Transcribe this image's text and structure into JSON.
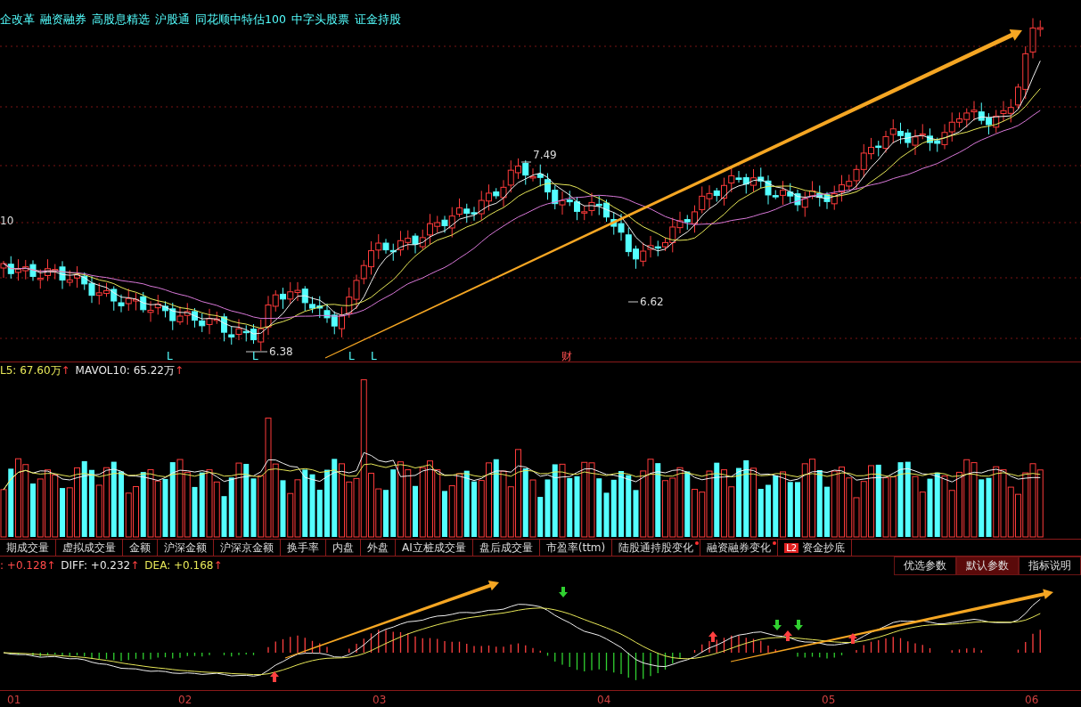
{
  "concept_tags": [
    "企改革",
    "融资融券",
    "高股息精选",
    "沪股通",
    "同花顺中特估100",
    "中字头股票",
    "证金持股"
  ],
  "price_panel": {
    "axis_label": "10",
    "annotations": [
      {
        "text": "7.49"
      },
      {
        "text": "6.38"
      },
      {
        "text": "6.62"
      }
    ],
    "markers": [
      {
        "text": "L",
        "kind": "signal"
      },
      {
        "text": "L",
        "kind": "signal"
      },
      {
        "text": "L",
        "kind": "signal"
      },
      {
        "text": "L",
        "kind": "signal"
      },
      {
        "text": "财",
        "kind": "report"
      }
    ]
  },
  "volume_panel": {
    "indicators": [
      {
        "text": "L5: 67.60万",
        "arrow": "↑",
        "color": "#e8e858"
      },
      {
        "text": "MAVOL10: 65.22万",
        "arrow": "↑",
        "color": "#e8e8e8"
      }
    ]
  },
  "indicator_tabs": [
    {
      "label": "期成交量",
      "dot": false
    },
    {
      "label": "虚拟成交量",
      "dot": false
    },
    {
      "label": "金额",
      "dot": false
    },
    {
      "label": "沪深金额",
      "dot": false
    },
    {
      "label": "沪深京金额",
      "dot": false
    },
    {
      "label": "换手率",
      "dot": false
    },
    {
      "label": "内盘",
      "dot": false
    },
    {
      "label": "外盘",
      "dot": false
    },
    {
      "label": "AI立桩成交量",
      "dot": false
    },
    {
      "label": "盘后成交量",
      "dot": false
    },
    {
      "label": "市盈率(ttm)",
      "dot": false
    },
    {
      "label": "陆股通持股变化",
      "dot": true
    },
    {
      "label": "融资融券变化",
      "dot": true
    },
    {
      "label": "资金抄底",
      "dot": false,
      "badge": "L2"
    }
  ],
  "macd_panel": {
    "indicators": [
      {
        "text": ": +0.128",
        "arrow": "↑",
        "color": "#ff4a4a"
      },
      {
        "text": "DIFF: +0.232",
        "arrow": "↑",
        "color": "#e8e8e8"
      },
      {
        "text": "DEA: +0.168",
        "arrow": "↑",
        "color": "#e8e858"
      }
    ],
    "param_buttons": [
      {
        "label": "优选参数",
        "selected": false
      },
      {
        "label": "默认参数",
        "selected": true
      },
      {
        "label": "指标说明",
        "selected": false
      }
    ]
  },
  "x_axis": [
    "01",
    "02",
    "03",
    "04",
    "05",
    "06"
  ]
}
